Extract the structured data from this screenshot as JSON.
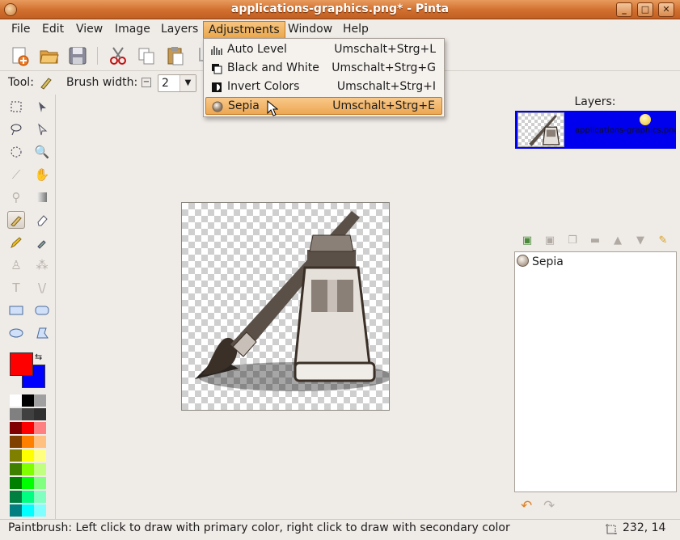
{
  "window": {
    "title": "applications-graphics.png* - Pinta"
  },
  "window_buttons": {
    "minimize": "_",
    "maximize": "□",
    "close": "✕"
  },
  "menubar": {
    "items": [
      {
        "label": "File"
      },
      {
        "label": "Edit"
      },
      {
        "label": "View"
      },
      {
        "label": "Image"
      },
      {
        "label": "Layers"
      },
      {
        "label": "Adjustments"
      },
      {
        "label": "Window"
      },
      {
        "label": "Help"
      }
    ],
    "active": "Adjustments"
  },
  "toolbar2": {
    "tool_label": "Tool:",
    "brush_width_label": "Brush width:",
    "brush_width_value": "2"
  },
  "adjustments_menu": {
    "items": [
      {
        "label": "Auto Level",
        "shortcut": "Umschalt+Strg+L",
        "icon": "auto-level-icon"
      },
      {
        "label": "Black and White",
        "shortcut": "Umschalt+Strg+G",
        "icon": "black-white-icon"
      },
      {
        "label": "Invert Colors",
        "shortcut": "Umschalt+Strg+I",
        "icon": "invert-colors-icon"
      },
      {
        "label": "Sepia",
        "shortcut": "Umschalt+Strg+E",
        "icon": "sepia-icon"
      }
    ],
    "highlighted": "Sepia"
  },
  "layers_panel": {
    "title": "Layers:",
    "layers": [
      {
        "name": "applications-graphics.png",
        "visible": true,
        "selected": true
      }
    ]
  },
  "history_panel": {
    "items": [
      {
        "label": "Sepia",
        "icon": "sepia-icon"
      }
    ]
  },
  "colors": {
    "primary": "#ff0000",
    "secondary": "#0000ff",
    "menu_highlight": "#eda752",
    "layer_selected": "#0000ee"
  },
  "palette": [
    "#ffffff",
    "#000000",
    "#a0a0a0",
    "#808080",
    "#404040",
    "#303030",
    "#800000",
    "#ff0000",
    "#ff8080",
    "#804000",
    "#ff8000",
    "#ffc080",
    "#808000",
    "#ffff00",
    "#ffff80",
    "#408000",
    "#80ff00",
    "#c0ff80",
    "#008000",
    "#00ff00",
    "#80ff80",
    "#008040",
    "#00ff80",
    "#80ffc0",
    "#008080",
    "#00ffff",
    "#80ffff"
  ],
  "statusbar": {
    "message": "Paintbrush: Left click to draw with primary color, right click to draw with secondary color",
    "cursor_position": "232, 14"
  }
}
